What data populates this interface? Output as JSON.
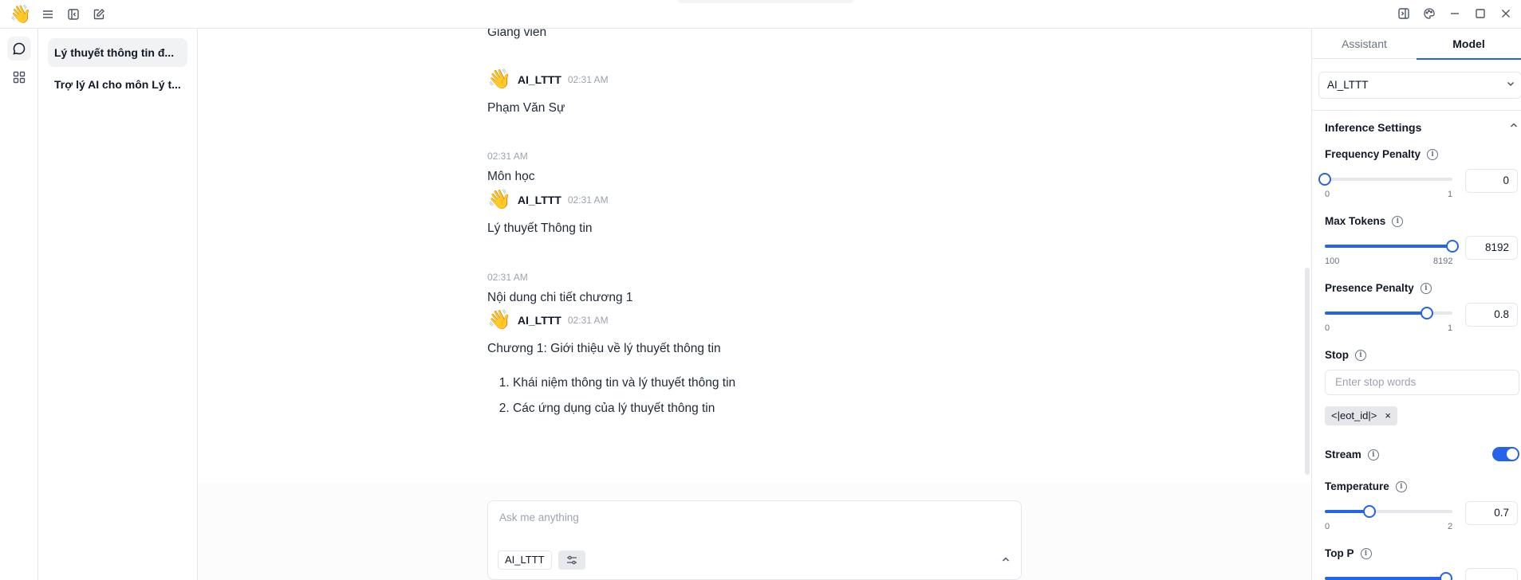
{
  "app": {
    "logo_emoji": "👋"
  },
  "threads": [
    {
      "title": "Lý thuyết thông tin đ...",
      "active": true
    },
    {
      "title": "Trợ lý AI cho môn Lý t...",
      "active": false
    }
  ],
  "chat": {
    "bot_name": "AI_LTTT",
    "bot_emoji": "👋",
    "messages": [
      {
        "text": "Giảng viên"
      },
      {
        "time": "02:31 AM",
        "text": "Phạm Văn Sự"
      },
      {
        "time": "02:31 AM",
        "text": "Môn học"
      },
      {
        "time": "02:31 AM",
        "text": "Lý thuyết Thông tin"
      },
      {
        "time": "02:31 AM",
        "text": "Nội dung chi tiết chương 1"
      },
      {
        "time": "02:31 AM",
        "text": "Chương 1: Giới thiệu về lý thuyết thông tin",
        "list": [
          "Khái niệm thông tin và lý thuyết thông tin",
          "Các ứng dụng của lý thuyết thông tin"
        ]
      }
    ]
  },
  "composer": {
    "placeholder": "Ask me anything",
    "model_chip": "AI_LTTT"
  },
  "panel": {
    "tabs": [
      "Assistant",
      "Model"
    ],
    "active_tab": "Model",
    "model_select": "AI_LTTT",
    "section_title": "Inference Settings",
    "frequency_penalty": {
      "label": "Frequency Penalty",
      "min": "0",
      "max": "1",
      "value": "0",
      "fraction": 0.0
    },
    "max_tokens": {
      "label": "Max Tokens",
      "min": "100",
      "max": "8192",
      "value": "8192",
      "fraction": 1.0
    },
    "presence_penalty": {
      "label": "Presence Penalty",
      "min": "0",
      "max": "1",
      "value": "0.8",
      "fraction": 0.8
    },
    "stop": {
      "label": "Stop",
      "placeholder": "Enter stop words",
      "tag": "<|eot_id|>",
      "tag_remove": "×"
    },
    "stream": {
      "label": "Stream",
      "enabled": true
    },
    "temperature": {
      "label": "Temperature",
      "min": "0",
      "max": "2",
      "value": "0.7",
      "fraction": 0.35
    },
    "top_p": {
      "label": "Top P",
      "fraction": 0.95
    },
    "info_glyph": "i",
    "accent_color": "#2563eb"
  }
}
